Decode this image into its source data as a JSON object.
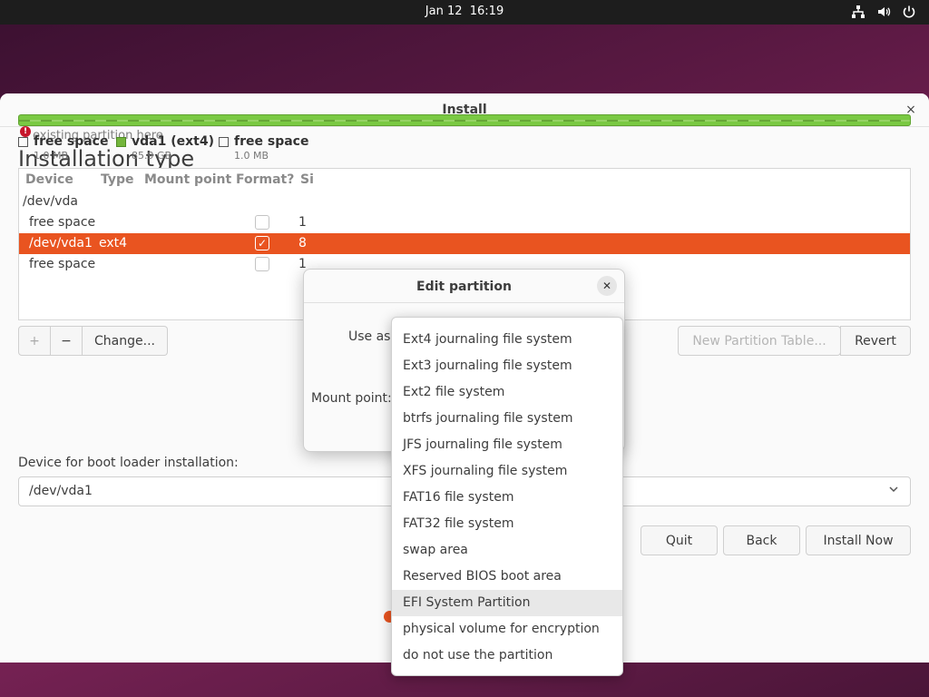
{
  "topbar": {
    "date": "Jan 12",
    "time": "16:19"
  },
  "window": {
    "title": "Install",
    "close_glyph": "×"
  },
  "page": {
    "title": "Installation type"
  },
  "partition_bar": {
    "overlap_text": "existing partition here"
  },
  "legend": [
    {
      "name": "free space",
      "size": "1.0 MB",
      "color": "#ffffff"
    },
    {
      "name": "vda1 (ext4)",
      "size": "85.9 GB",
      "color": "#73b53b"
    },
    {
      "name": "free space",
      "size": "1.0 MB",
      "color": "#ffffff"
    }
  ],
  "table": {
    "headers": [
      "Device",
      "Type",
      "Mount point",
      "Format?",
      "Si"
    ],
    "rows": [
      {
        "device": "/dev/vda",
        "type": "",
        "size": ""
      },
      {
        "device": "free space",
        "type": "",
        "size": "1"
      },
      {
        "device": "/dev/vda1",
        "type": "ext4",
        "size": "8"
      },
      {
        "device": "free space",
        "type": "",
        "size": "1"
      }
    ]
  },
  "toolbar": {
    "add": "+",
    "remove": "−",
    "change": "Change...",
    "new_table": "New Partition Table...",
    "revert": "Revert"
  },
  "boot": {
    "label": "Device for boot loader installation:",
    "value": "/dev/vda1"
  },
  "nav": {
    "quit": "Quit",
    "back": "Back",
    "install": "Install Now"
  },
  "dialog": {
    "title": "Edit partition",
    "use_as": "Use as:",
    "mount_point": "Mount point:",
    "close_glyph": "✕"
  },
  "use_as_options": [
    "Ext4 journaling file system",
    "Ext3 journaling file system",
    "Ext2 file system",
    "btrfs journaling file system",
    "JFS journaling file system",
    "XFS journaling file system",
    "FAT16 file system",
    "FAT32 file system",
    "swap area",
    "Reserved BIOS boot area",
    "EFI System Partition",
    "physical volume for encryption",
    "do not use the partition"
  ],
  "colors": {
    "accent": "#e95420",
    "partition_green": "#73b53b"
  },
  "icons": {
    "tray": [
      "network-icon",
      "volume-icon",
      "power-icon"
    ]
  }
}
